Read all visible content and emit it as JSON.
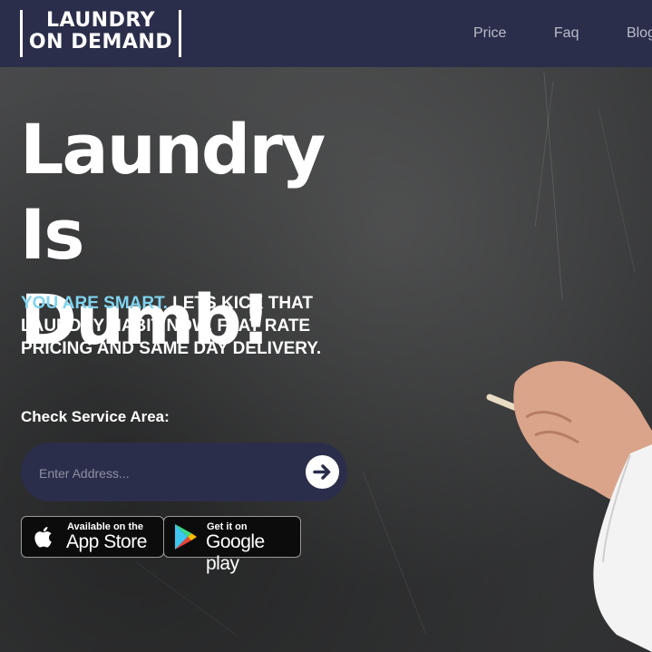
{
  "logo": {
    "line1": "LAUNDRY",
    "line2": "ON DEMAND"
  },
  "nav": {
    "items": [
      {
        "label": "Price"
      },
      {
        "label": "Faq"
      },
      {
        "label": "Blog"
      }
    ]
  },
  "hero": {
    "headline_line1": "Laundry Is",
    "headline_line2": "Dumb!",
    "tagline_accent": "YOU ARE SMART.",
    "tagline_rest": "LETS KICK THAT LAUNDRY HABIT NOW. FLAT RATE PRICING AND SAME DAY DELIVERY."
  },
  "service": {
    "label": "Check Service Area:",
    "placeholder": "Enter Address...",
    "submit_icon": "arrow-right-circle-icon"
  },
  "badges": {
    "apple": {
      "small": "Available on the",
      "big": "App Store",
      "icon": "apple-icon"
    },
    "google": {
      "small": "Get it on",
      "big": "Google play",
      "icon": "google-play-icon"
    }
  },
  "colors": {
    "nav_bg": "#2b2e4a",
    "accent": "#7fd3ee",
    "nav_text": "#b9bccb"
  }
}
